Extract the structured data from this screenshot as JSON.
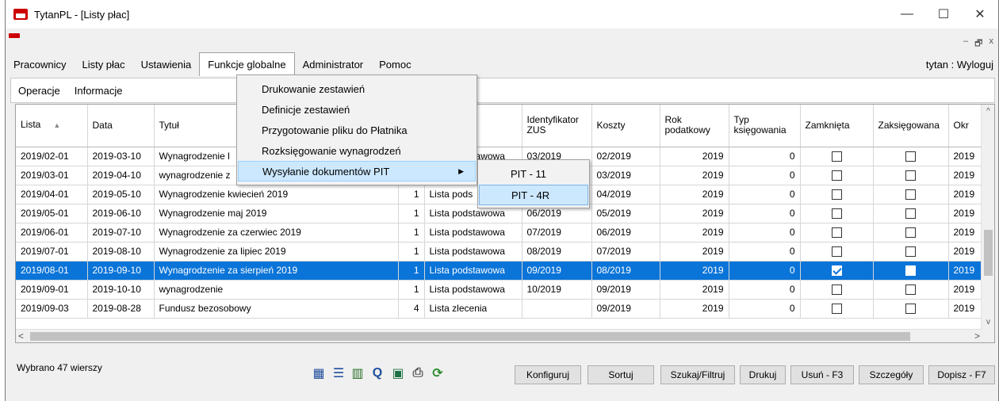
{
  "app": {
    "title": "TytanPL - [Listy płac]"
  },
  "window_controls": {
    "minimize": "—",
    "maximize": "☐",
    "close": "✕"
  },
  "mdi_controls": {
    "minimize": "–",
    "restore": "🗗",
    "close": "x"
  },
  "menu": {
    "items": [
      {
        "label": "Pracownicy"
      },
      {
        "label": "Listy płac"
      },
      {
        "label": "Ustawienia"
      },
      {
        "label": "Funkcje globalne"
      },
      {
        "label": "Administrator"
      },
      {
        "label": "Pomoc"
      }
    ],
    "user": "tytan : Wyloguj"
  },
  "toolbar2": {
    "items": [
      {
        "label": "Operacje"
      },
      {
        "label": "Informacje"
      }
    ]
  },
  "dropdown": {
    "items": [
      {
        "label": "Drukowanie zestawień"
      },
      {
        "label": "Definicje zestawień"
      },
      {
        "label": "Przygotowanie pliku do Płatnika"
      },
      {
        "label": "Rozksięgowanie wynagrodzeń"
      },
      {
        "label": "Wysyłanie dokumentów PIT"
      }
    ],
    "submenu_arrow": "▶",
    "submenu": [
      {
        "label": "PIT - 11"
      },
      {
        "label": "PIT - 4R"
      }
    ]
  },
  "grid": {
    "headers": [
      {
        "label": "Lista"
      },
      {
        "label": "Data"
      },
      {
        "label": "Tytuł"
      },
      {
        "label": ""
      },
      {
        "label": ""
      },
      {
        "label": "Identyfikator ZUS"
      },
      {
        "label": "Koszty"
      },
      {
        "label": "Rok podatkowy"
      },
      {
        "label": "Typ księgowania"
      },
      {
        "label": "Zamknięta"
      },
      {
        "label": "Zaksięgowana"
      },
      {
        "label": "Okr"
      }
    ],
    "sort_arrow": "▲",
    "rows": [
      {
        "lista": "2019/02-01",
        "data": "2019-03-10",
        "tytul": "Wynagrodzenie l",
        "nr": "",
        "rodzaj": "Lista podstawowa",
        "zus": "03/2019",
        "koszty": "02/2019",
        "rok": "2019",
        "typ": "0",
        "zamk": false,
        "zaks": false,
        "okr": "2019"
      },
      {
        "lista": "2019/03-01",
        "data": "2019-04-10",
        "tytul": "wynagrodzenie z",
        "nr": "",
        "rodzaj": "",
        "zus": "",
        "koszty": "03/2019",
        "rok": "2019",
        "typ": "0",
        "zamk": false,
        "zaks": false,
        "okr": "2019"
      },
      {
        "lista": "2019/04-01",
        "data": "2019-05-10",
        "tytul": "Wynagrodzenie kwiecień 2019",
        "nr": "1",
        "rodzaj": "Lista pods",
        "zus": "",
        "koszty": "04/2019",
        "rok": "2019",
        "typ": "0",
        "zamk": false,
        "zaks": false,
        "okr": "2019"
      },
      {
        "lista": "2019/05-01",
        "data": "2019-06-10",
        "tytul": "Wynagrodzenie maj 2019",
        "nr": "1",
        "rodzaj": "Lista podstawowa",
        "zus": "06/2019",
        "koszty": "05/2019",
        "rok": "2019",
        "typ": "0",
        "zamk": false,
        "zaks": false,
        "okr": "2019"
      },
      {
        "lista": "2019/06-01",
        "data": "2019-07-10",
        "tytul": "Wynagrodzenie za czerwiec 2019",
        "nr": "1",
        "rodzaj": "Lista podstawowa",
        "zus": "07/2019",
        "koszty": "06/2019",
        "rok": "2019",
        "typ": "0",
        "zamk": false,
        "zaks": false,
        "okr": "2019"
      },
      {
        "lista": "2019/07-01",
        "data": "2019-08-10",
        "tytul": "Wynagrodzenie za lipiec 2019",
        "nr": "1",
        "rodzaj": "Lista podstawowa",
        "zus": "08/2019",
        "koszty": "07/2019",
        "rok": "2019",
        "typ": "0",
        "zamk": false,
        "zaks": false,
        "okr": "2019"
      },
      {
        "lista": "2019/08-01",
        "data": "2019-09-10",
        "tytul": "Wynagrodzenie za sierpień 2019",
        "nr": "1",
        "rodzaj": "Lista podstawowa",
        "zus": "09/2019",
        "koszty": "08/2019",
        "rok": "2019",
        "typ": "0",
        "zamk": true,
        "zaks": false,
        "okr": "2019",
        "selected": true
      },
      {
        "lista": "2019/09-01",
        "data": "2019-10-10",
        "tytul": "wynagrodzenie",
        "nr": "1",
        "rodzaj": "Lista podstawowa",
        "zus": "10/2019",
        "koszty": "09/2019",
        "rok": "2019",
        "typ": "0",
        "zamk": false,
        "zaks": false,
        "okr": "2019"
      },
      {
        "lista": "2019/09-03",
        "data": "2019-08-28",
        "tytul": "Fundusz bezosobowy",
        "nr": "4",
        "rodzaj": "Lista zlecenia",
        "zus": "",
        "koszty": "09/2019",
        "rok": "2019",
        "typ": "0",
        "zamk": false,
        "zaks": false,
        "okr": "2019"
      }
    ]
  },
  "scroll": {
    "up": "^",
    "down": "v",
    "left": "<",
    "right": ">"
  },
  "status": {
    "text": "Wybrano 47 wierszy"
  },
  "bottom_icons": [
    {
      "name": "grid-view-icon",
      "color": "#1f4e9c"
    },
    {
      "name": "list-view-icon",
      "color": "#1f4e9c"
    },
    {
      "name": "chart-icon",
      "color": "#2a6f2a"
    },
    {
      "name": "query-icon",
      "color": "#1f4e9c"
    },
    {
      "name": "excel-icon",
      "color": "#1e7145"
    },
    {
      "name": "print-icon",
      "color": "#555555"
    },
    {
      "name": "refresh-icon",
      "color": "#2a8a2a"
    }
  ],
  "buttons": [
    {
      "label": "Konfiguruj"
    },
    {
      "label": "Sortuj"
    },
    {
      "label": "Szukaj/Filtruj"
    },
    {
      "label": "Drukuj"
    },
    {
      "label": "Usuń - F3"
    },
    {
      "label": "Szczegóły"
    },
    {
      "label": "Dopisz - F7"
    }
  ]
}
